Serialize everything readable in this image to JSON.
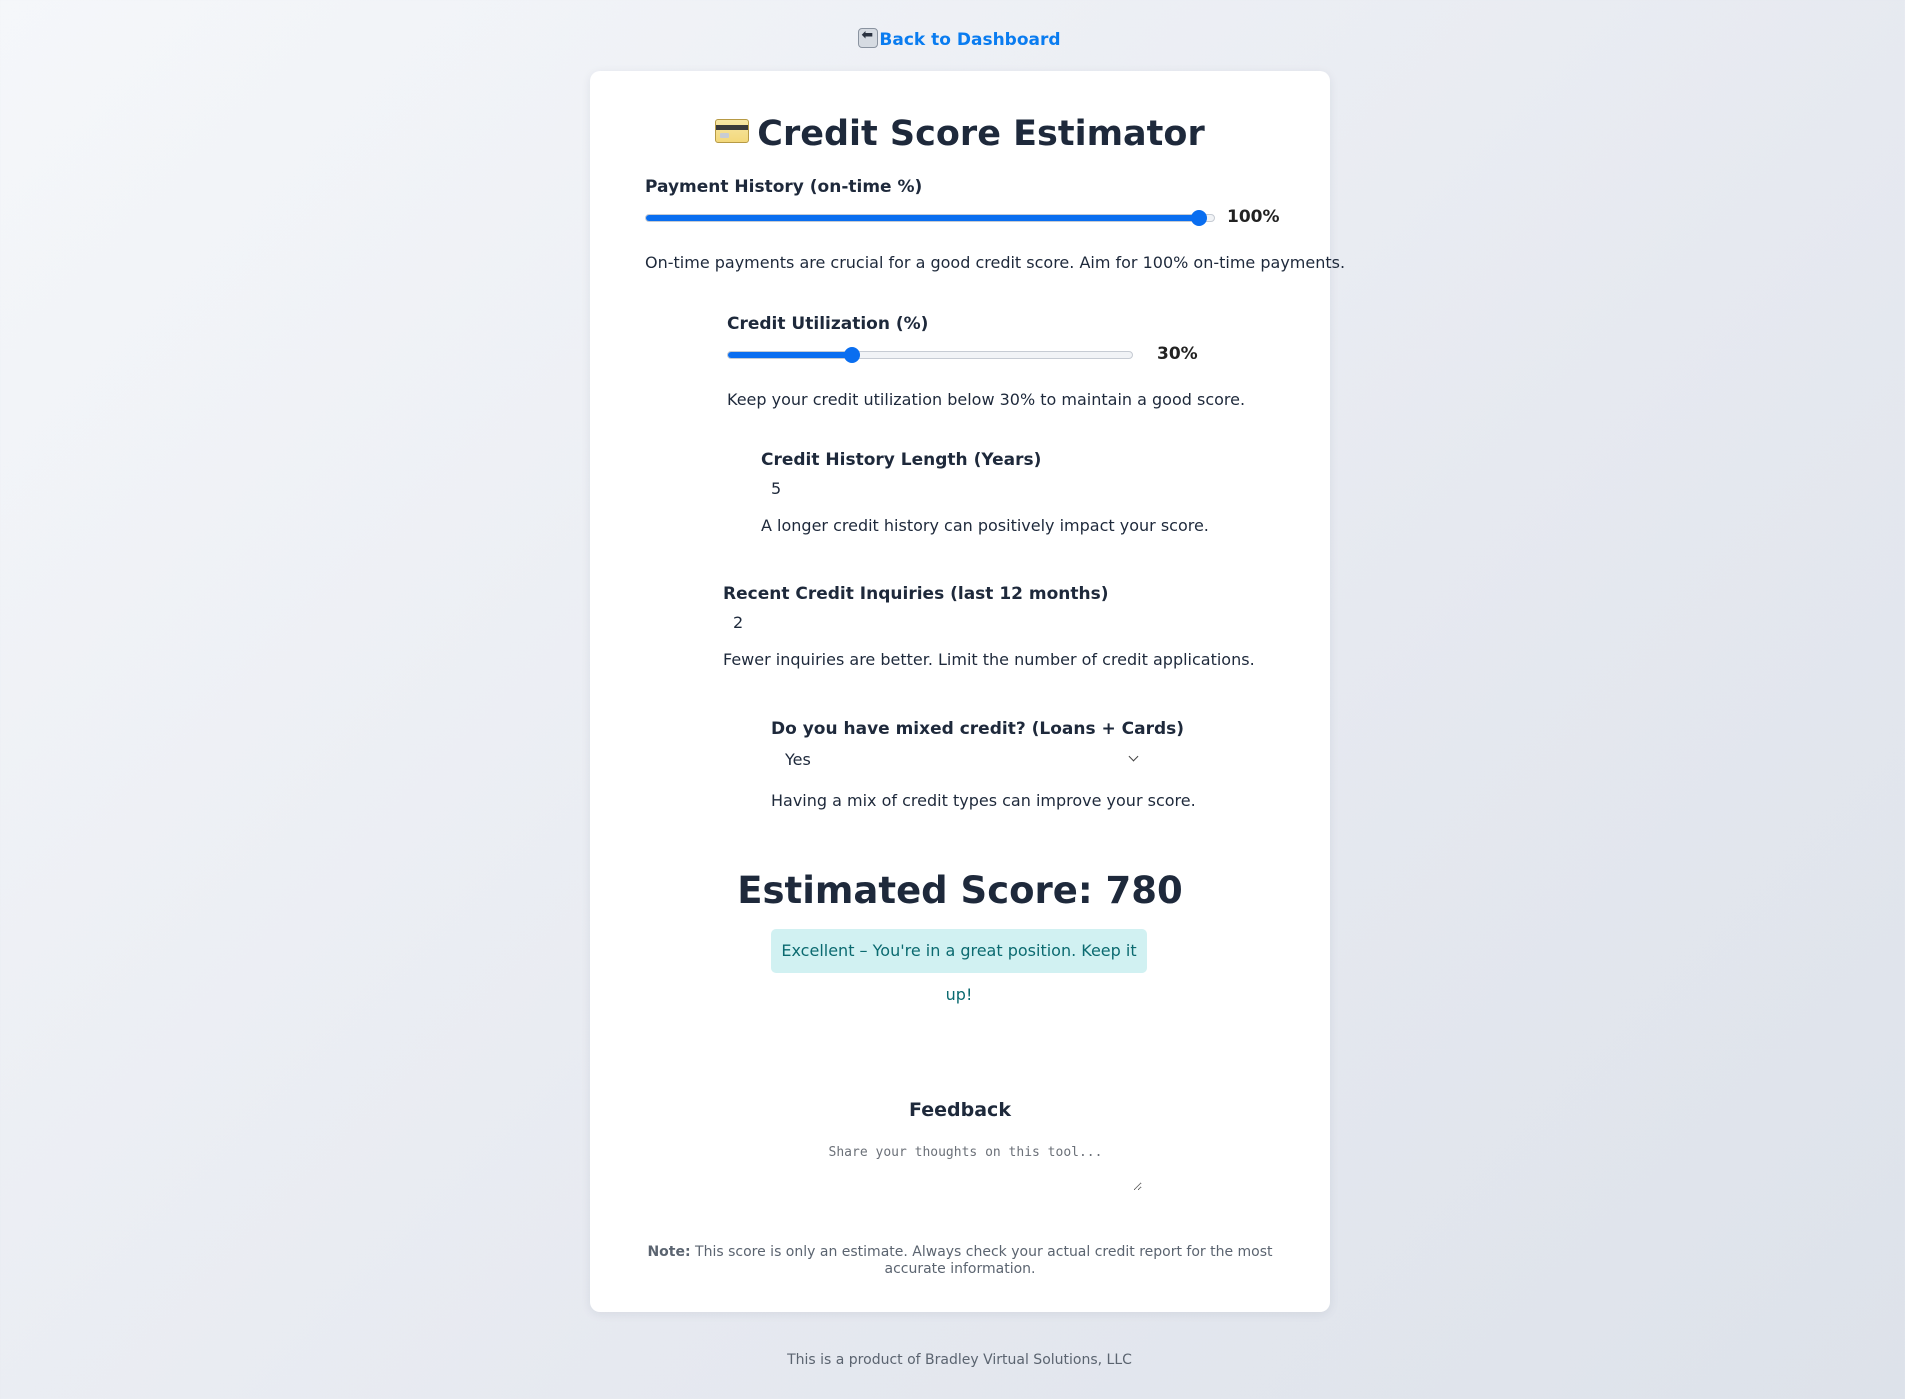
{
  "nav": {
    "back_label": "Back to Dashboard"
  },
  "header": {
    "title": "Credit Score Estimator"
  },
  "payment_history": {
    "label": "Payment History (on-time %)",
    "value_percent": 100,
    "value_text": "100%",
    "hint": "On-time payments are crucial for a good credit score. Aim for 100% on-time payments."
  },
  "utilization": {
    "label": "Credit Utilization (%)",
    "value_percent": 30,
    "value_text": "30%",
    "hint": "Keep your credit utilization below 30% to maintain a good score."
  },
  "history_length": {
    "label": "Credit History Length (Years)",
    "value": "5",
    "hint": "A longer credit history can positively impact your score."
  },
  "inquiries": {
    "label": "Recent Credit Inquiries (last 12 months)",
    "value": "2",
    "hint": "Fewer inquiries are better. Limit the number of credit applications."
  },
  "mixed_credit": {
    "label": "Do you have mixed credit? (Loans + Cards)",
    "selected": "Yes",
    "hint": "Having a mix of credit types can improve your score."
  },
  "result": {
    "score_text": "Estimated Score: 780",
    "rating_text": "Excellent – You're in a great position. Keep it up!"
  },
  "feedback": {
    "title": "Feedback",
    "placeholder": "Share your thoughts on this tool..."
  },
  "note": {
    "label": "Note:",
    "text": "This score is only an estimate. Always check your actual credit report for the most accurate information."
  },
  "footer": {
    "text": "This is a product of Bradley Virtual Solutions, LLC"
  },
  "colors": {
    "accent": "#0a6ef0",
    "link": "#0a7cf0",
    "badge_bg": "#d1f1f2",
    "badge_text": "#0b6a70"
  },
  "icons": {
    "back": "back-arrow-icon",
    "title": "credit-card-icon",
    "select": "chevron-down-icon"
  }
}
